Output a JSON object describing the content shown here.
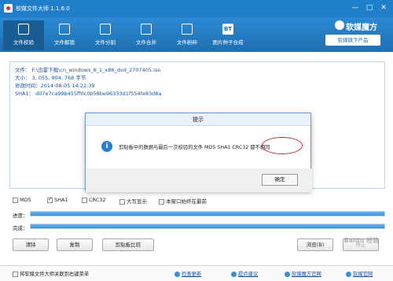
{
  "window": {
    "title": "软媒文件大师 1.1.6.0",
    "controls": [
      "—",
      "□",
      "✕"
    ]
  },
  "toolbar": {
    "tabs": [
      {
        "label": "文件校验",
        "icon": "file-check-icon"
      },
      {
        "label": "文件解锁",
        "icon": "lock-icon"
      },
      {
        "label": "文件分割",
        "icon": "split-icon"
      },
      {
        "label": "文件合并",
        "icon": "merge-icon"
      },
      {
        "label": "文件粉碎",
        "icon": "shredder-icon"
      },
      {
        "label": "图片种子合成",
        "icon": "bt-icon",
        "glyph": "BT"
      }
    ],
    "brand": "软媒魔方",
    "product_button": "软媒旗下产品"
  },
  "info": {
    "file_line": "文件：    F:\\迅雷下载\\cn_windows_8_1_x86_dvd_2707405.iso",
    "size_line": "大小：    3, 055, 904, 768 字节",
    "modified_line": "修改时间：2014-08-05 14:22:39",
    "sha1_line": "SHA1：  d07e7ca99b455ff0c0b58be96333d1f554fe83d8a"
  },
  "dialog": {
    "title": "提示",
    "message": "剪贴板中的数据与最后一次校验的文件 MD5 SHA1 CRC32 都不相同",
    "ok": "确定",
    "icon": "info-icon"
  },
  "options": {
    "md5": {
      "label": "MD5",
      "checked": false
    },
    "sha1": {
      "label": "SHA1",
      "checked": true
    },
    "crc32": {
      "label": "CRC32",
      "checked": false
    },
    "uppercase": {
      "label": "大写显示",
      "checked": false
    },
    "topmost": {
      "label": "本窗口始终在最前",
      "checked": false
    }
  },
  "progress": {
    "current_label": "进度：",
    "current_value": 1.0,
    "overall_label": "完成：",
    "overall_value": 1.0
  },
  "buttons": {
    "clear": "清除",
    "copy": "复制",
    "compare": "剪贴板比较",
    "browse": "浏览(B)",
    "stop": "停止"
  },
  "statusbar": {
    "context_menu": "将软媒文件大师关联到右键菜单",
    "check_update": "检查更新",
    "feedback": "提点建议",
    "website": "软媒魔方官网",
    "official": "软媒官网"
  },
  "watermark": "Baidu 经验"
}
